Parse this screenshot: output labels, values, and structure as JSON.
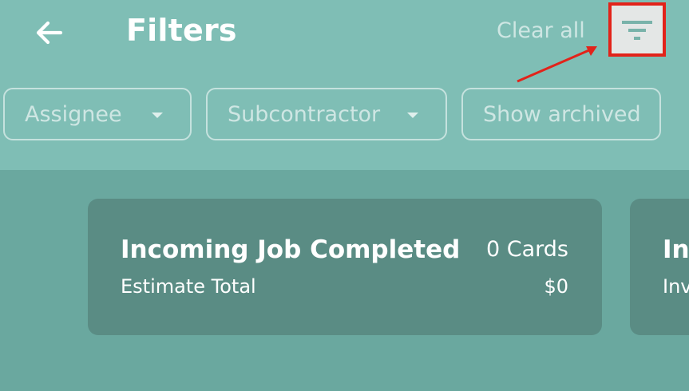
{
  "header": {
    "title": "Filters",
    "clear_all_label": "Clear all",
    "back_icon": "arrow-left-icon",
    "filter_icon": "filter-lines-icon"
  },
  "chips": [
    {
      "label": "Assignee",
      "has_dropdown": true
    },
    {
      "label": "Subcontractor",
      "has_dropdown": true
    },
    {
      "label": "Show archived",
      "has_dropdown": false
    }
  ],
  "cards": [
    {
      "title": "Incoming Job Completed",
      "count": "0 Cards",
      "subtitle": "Estimate Total",
      "amount": "$0"
    },
    {
      "title": "Inv",
      "subtitle": "Inv"
    }
  ],
  "colors": {
    "header_bg": "#7fbeb5",
    "body_bg": "#6aa89f",
    "card_bg": "#5a8c84",
    "highlight": "#e2231a",
    "filter_button_bg": "#e4e7e6",
    "filter_icon": "#79b3aa"
  }
}
